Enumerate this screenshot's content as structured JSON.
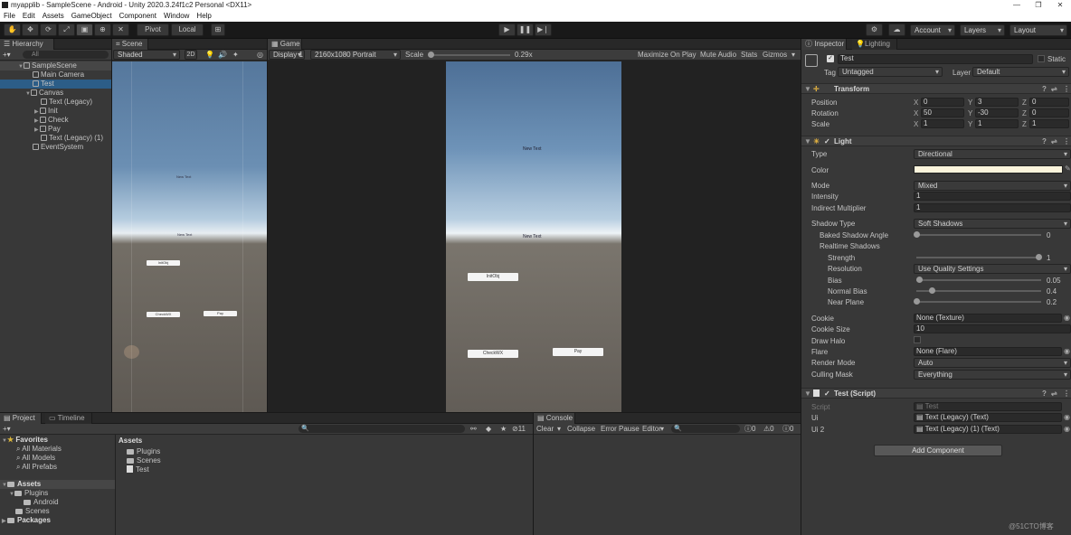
{
  "window": {
    "title": "myapplib - SampleScene - Android - Unity 2020.3.24f1c2 Personal <DX11>"
  },
  "menu": [
    "File",
    "Edit",
    "Assets",
    "GameObject",
    "Component",
    "Window",
    "Help"
  ],
  "toolbar": {
    "pivot": "Pivot",
    "local": "Local",
    "account": "Account",
    "layers": "Layers",
    "layout": "Layout"
  },
  "hierarchy": {
    "tab": "Hierarchy",
    "search_placeholder": "All",
    "items": [
      {
        "label": "SampleScene"
      },
      {
        "label": "Main Camera"
      },
      {
        "label": "Test"
      },
      {
        "label": "Canvas"
      },
      {
        "label": "Text (Legacy)"
      },
      {
        "label": "Init"
      },
      {
        "label": "Check"
      },
      {
        "label": "Pay"
      },
      {
        "label": "Text (Legacy) (1)"
      },
      {
        "label": "EventSystem"
      }
    ]
  },
  "scene": {
    "tab": "Scene",
    "shading": "Shaded",
    "mode2d": "2D",
    "labels": {
      "text1": "New Text",
      "text2": "New Text",
      "init": "InitObj",
      "check": "CheckWX",
      "pay": "Pay"
    }
  },
  "game": {
    "tab": "Game",
    "display": "Display 1",
    "resolution": "2160x1080 Portrait",
    "scale_label": "Scale",
    "scale_value": "0.29x",
    "maximize": "Maximize On Play",
    "mute": "Mute Audio",
    "stats": "Stats",
    "gizmos": "Gizmos",
    "labels": {
      "text1": "New Text",
      "text2": "New Text",
      "init": "InitObj",
      "check": "CheckWX",
      "pay": "Pay"
    }
  },
  "inspector": {
    "tab": "Inspector",
    "lighting_tab": "Lighting",
    "object_name": "Test",
    "static": "Static",
    "tag_label": "Tag",
    "tag_value": "Untagged",
    "layer_label": "Layer",
    "layer_value": "Default",
    "transform": {
      "title": "Transform",
      "position": {
        "label": "Position",
        "x": "0",
        "y": "3",
        "z": "0"
      },
      "rotation": {
        "label": "Rotation",
        "x": "50",
        "y": "-30",
        "z": "0"
      },
      "scale": {
        "label": "Scale",
        "x": "1",
        "y": "1",
        "z": "1"
      }
    },
    "light": {
      "title": "Light",
      "type_label": "Type",
      "type_value": "Directional",
      "color_label": "Color",
      "color_value": "#fbf4dc",
      "mode_label": "Mode",
      "mode_value": "Mixed",
      "intensity_label": "Intensity",
      "intensity_value": "1",
      "indirect_label": "Indirect Multiplier",
      "indirect_value": "1",
      "shadow_type_label": "Shadow Type",
      "shadow_type_value": "Soft Shadows",
      "baked_angle_label": "Baked Shadow Angle",
      "baked_angle_value": "0",
      "realtime_label": "Realtime Shadows",
      "strength_label": "Strength",
      "strength_value": "1",
      "resolution_label": "Resolution",
      "resolution_value": "Use Quality Settings",
      "bias_label": "Bias",
      "bias_value": "0.05",
      "normal_bias_label": "Normal Bias",
      "normal_bias_value": "0.4",
      "near_plane_label": "Near Plane",
      "near_plane_value": "0.2",
      "cookie_label": "Cookie",
      "cookie_value": "None (Texture)",
      "cookie_size_label": "Cookie Size",
      "cookie_size_value": "10",
      "draw_halo_label": "Draw Halo",
      "flare_label": "Flare",
      "flare_value": "None (Flare)",
      "render_mode_label": "Render Mode",
      "render_mode_value": "Auto",
      "culling_label": "Culling Mask",
      "culling_value": "Everything"
    },
    "script": {
      "title": "Test (Script)",
      "script_label": "Script",
      "script_value": "Test",
      "ui_label": "Ui",
      "ui_value": "Text (Legacy) (Text)",
      "ui2_label": "Ui 2",
      "ui2_value": "Text (Legacy) (1) (Text)"
    },
    "add_component": "Add Component"
  },
  "project": {
    "tab": "Project",
    "timeline_tab": "Timeline",
    "favorites": "Favorites",
    "fav_items": [
      "All Materials",
      "All Models",
      "All Prefabs"
    ],
    "assets": "Assets",
    "tree": [
      "Plugins",
      "Android",
      "Scenes"
    ],
    "packages": "Packages",
    "assets_header": "Assets",
    "asset_items": [
      "Plugins",
      "Scenes",
      "Test"
    ],
    "count": "11"
  },
  "console": {
    "tab": "Console",
    "clear": "Clear",
    "collapse": "Collapse",
    "error_pause": "Error Pause",
    "editor": "Editor",
    "counts": [
      "0",
      "0",
      "0"
    ]
  },
  "watermark": "@51CTO博客"
}
